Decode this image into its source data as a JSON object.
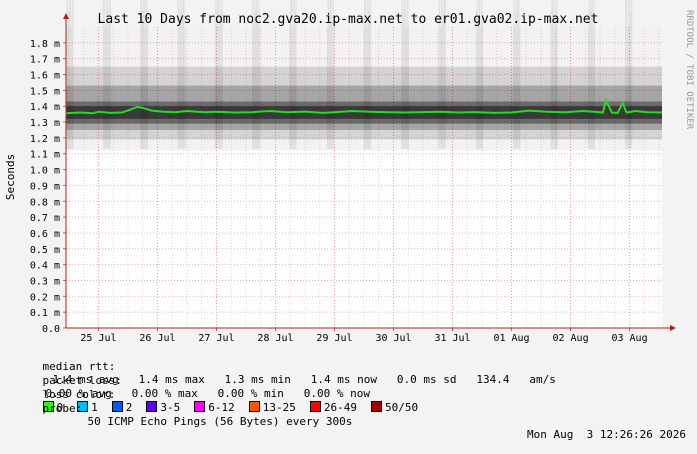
{
  "chart_data": {
    "type": "line",
    "title": "Last 10 Days from noc2.gva20.ip-max.net to er01.gva02.ip-max.net",
    "ylabel": "Seconds",
    "ylim": [
      0,
      0.0019
    ],
    "y_ticks": [
      {
        "v": 0.0,
        "label": "0.0"
      },
      {
        "v": 0.0001,
        "label": "0.1 m"
      },
      {
        "v": 0.0002,
        "label": "0.2 m"
      },
      {
        "v": 0.0003,
        "label": "0.3 m"
      },
      {
        "v": 0.0004,
        "label": "0.4 m"
      },
      {
        "v": 0.0005,
        "label": "0.5 m"
      },
      {
        "v": 0.0006,
        "label": "0.6 m"
      },
      {
        "v": 0.0007,
        "label": "0.7 m"
      },
      {
        "v": 0.0008,
        "label": "0.8 m"
      },
      {
        "v": 0.0009,
        "label": "0.9 m"
      },
      {
        "v": 0.001,
        "label": "1.0 m"
      },
      {
        "v": 0.0011,
        "label": "1.1 m"
      },
      {
        "v": 0.0012,
        "label": "1.2 m"
      },
      {
        "v": 0.0013,
        "label": "1.3 m"
      },
      {
        "v": 0.0014,
        "label": "1.4 m"
      },
      {
        "v": 0.0015,
        "label": "1.5 m"
      },
      {
        "v": 0.0016,
        "label": "1.6 m"
      },
      {
        "v": 0.0017,
        "label": "1.7 m"
      },
      {
        "v": 0.0018,
        "label": "1.8 m"
      }
    ],
    "x_ticks": [
      "25 Jul",
      "26 Jul",
      "27 Jul",
      "28 Jul",
      "29 Jul",
      "30 Jul",
      "31 Jul",
      "01 Aug",
      "02 Aug",
      "03 Aug"
    ],
    "x_range_days": [
      -0.55,
      9.55
    ],
    "grid": true,
    "series": [
      {
        "name": "median rtt",
        "color": "#22dd22",
        "x_days": [
          -0.55,
          -0.3,
          -0.1,
          0.0,
          0.2,
          0.4,
          0.55,
          0.65,
          0.75,
          0.9,
          1.1,
          1.3,
          1.5,
          1.8,
          2.0,
          2.3,
          2.6,
          2.9,
          3.2,
          3.5,
          3.8,
          4.0,
          4.3,
          4.6,
          4.9,
          5.2,
          5.5,
          5.8,
          6.1,
          6.4,
          6.7,
          7.0,
          7.3,
          7.6,
          7.9,
          8.2,
          8.4,
          8.55,
          8.6,
          8.7,
          8.8,
          8.88,
          8.95,
          9.1,
          9.3,
          9.55
        ],
        "y": [
          0.001355,
          0.00136,
          0.001355,
          0.001365,
          0.001358,
          0.00136,
          0.00138,
          0.001395,
          0.00139,
          0.001372,
          0.001365,
          0.001362,
          0.00137,
          0.001362,
          0.001365,
          0.00136,
          0.001362,
          0.00137,
          0.001362,
          0.001366,
          0.001358,
          0.001362,
          0.00137,
          0.001365,
          0.001362,
          0.00136,
          0.001363,
          0.001365,
          0.00136,
          0.001363,
          0.001358,
          0.00136,
          0.001372,
          0.001365,
          0.001362,
          0.00137,
          0.001365,
          0.00136,
          0.00144,
          0.00136,
          0.001358,
          0.00142,
          0.00136,
          0.00137,
          0.001362,
          0.00136
        ]
      }
    ],
    "smoke": {
      "low": 0.00125,
      "high": 0.00145,
      "color": "#000000"
    }
  },
  "watermark": "RRDTOOL / TOBI OETIKER",
  "legend": {
    "median_label": "median rtt:",
    "median_values": "1.4 ms avg   1.4 ms max   1.3 ms min   1.4 ms now   0.0 ms sd   134.4   am/s",
    "loss_label": "packet loss:",
    "loss_values": "0.00 % avg   0.00 % max   0.00 % min   0.00 % now",
    "color_label": "loss color:",
    "colors": [
      {
        "label": "0",
        "color": "#26ff00"
      },
      {
        "label": "1",
        "color": "#00b8ff"
      },
      {
        "label": "2",
        "color": "#0059ff"
      },
      {
        "label": "3-5",
        "color": "#5e00ff"
      },
      {
        "label": "6-12",
        "color": "#ff00ff"
      },
      {
        "label": "13-25",
        "color": "#ff5500"
      },
      {
        "label": "26-49",
        "color": "#ff0000"
      },
      {
        "label": "50/50",
        "color": "#a10000"
      }
    ],
    "probe_label": "probe:",
    "probe_value": "50 ICMP Echo Pings (56 Bytes) every 300s",
    "timestamp": "Mon Aug  3 12:26:26 2026"
  }
}
